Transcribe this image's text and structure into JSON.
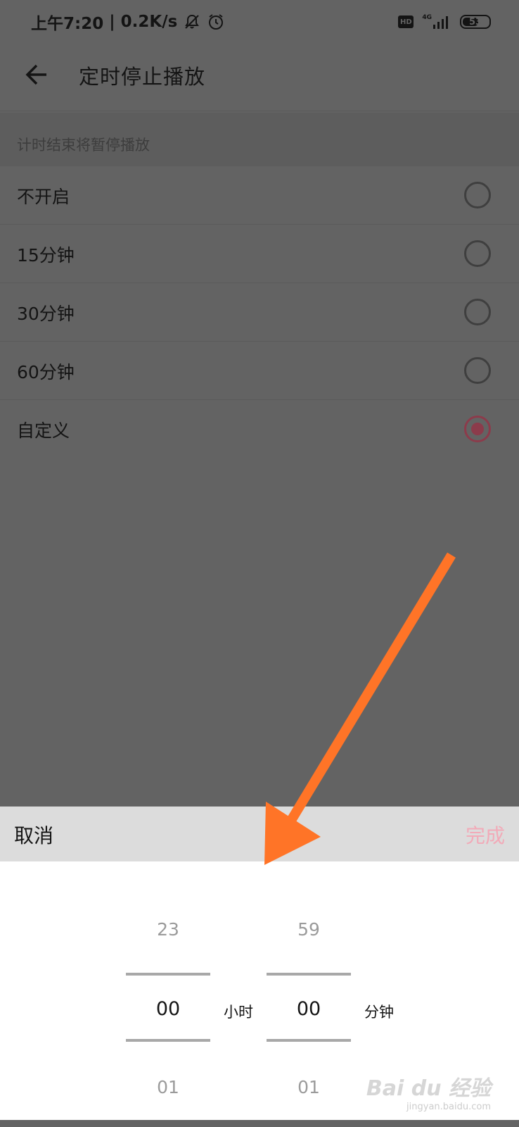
{
  "status_bar": {
    "time": "上午7:20",
    "separator": "|",
    "net_speed": "0.2K/s",
    "hd_label": "HD",
    "network_type": "4G",
    "battery_level": "53",
    "icons": [
      "mute-icon",
      "alarm-icon",
      "hd-icon",
      "signal-icon",
      "battery-icon"
    ]
  },
  "header": {
    "title": "定时停止播放",
    "back_icon": "arrow-left-icon"
  },
  "section_hint": "计时结束将暂停播放",
  "options": [
    {
      "label": "不开启",
      "selected": false
    },
    {
      "label": "15分钟",
      "selected": false
    },
    {
      "label": "30分钟",
      "selected": false
    },
    {
      "label": "60分钟",
      "selected": false
    },
    {
      "label": "自定义",
      "selected": true
    }
  ],
  "sheet": {
    "cancel_label": "取消",
    "done_label": "完成",
    "hours": {
      "prev": "23",
      "current": "00",
      "next": "01",
      "unit": "小时"
    },
    "minutes": {
      "prev": "59",
      "current": "00",
      "next": "01",
      "unit": "分钟"
    }
  },
  "watermark": {
    "text": "Bai du 经验",
    "sub": "jingyan.baidu.com"
  },
  "colors": {
    "dim_overlay": "#636363",
    "accent": "#8c3b4b",
    "done_disabled": "#f2aab8",
    "annotation_arrow": "#ff7427"
  }
}
